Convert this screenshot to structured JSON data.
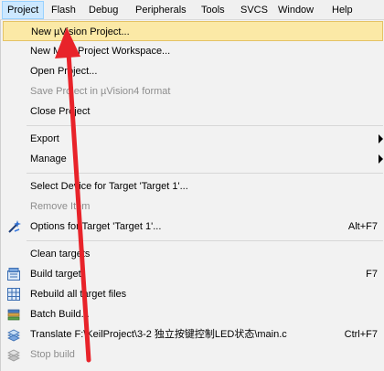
{
  "menubar": {
    "items": [
      {
        "label": "Project",
        "active": true
      },
      {
        "label": "Flash"
      },
      {
        "label": "Debug"
      },
      {
        "label": "Peripherals"
      },
      {
        "label": "Tools"
      },
      {
        "label": "SVCS"
      },
      {
        "label": "Window"
      },
      {
        "label": "Help"
      }
    ]
  },
  "project_menu": {
    "items": [
      {
        "label": "New µVision Project...",
        "highlighted": true
      },
      {
        "label": "New Multi-Project Workspace..."
      },
      {
        "label": "Open Project..."
      },
      {
        "label": "Save Project in µVision4 format",
        "disabled": true
      },
      {
        "label": "Close Project"
      },
      {
        "label": "Export",
        "submenu": true
      },
      {
        "label": "Manage",
        "submenu": true
      },
      {
        "label": "Select Device for Target 'Target 1'..."
      },
      {
        "label": "Remove Item",
        "disabled": true
      },
      {
        "label": "Options for Target 'Target 1'...",
        "shortcut": "Alt+F7",
        "icon": "options-wand-icon"
      },
      {
        "label": "Clean targets"
      },
      {
        "label": "Build target",
        "shortcut": "F7",
        "icon": "build-icon"
      },
      {
        "label": "Rebuild all target files",
        "icon": "rebuild-icon"
      },
      {
        "label": "Batch Build...",
        "icon": "batch-build-icon"
      },
      {
        "label": "Translate F:\\KeilProject\\3-2 独立按键控制LED状态\\main.c",
        "shortcut": "Ctrl+F7",
        "icon": "translate-icon"
      },
      {
        "label": "Stop build",
        "disabled": true,
        "icon": "stop-build-icon"
      }
    ]
  },
  "colors": {
    "highlight_fill": "#fbe9a6",
    "menubar_active": "#cce8ff",
    "annotation_arrow": "#e8232a"
  }
}
